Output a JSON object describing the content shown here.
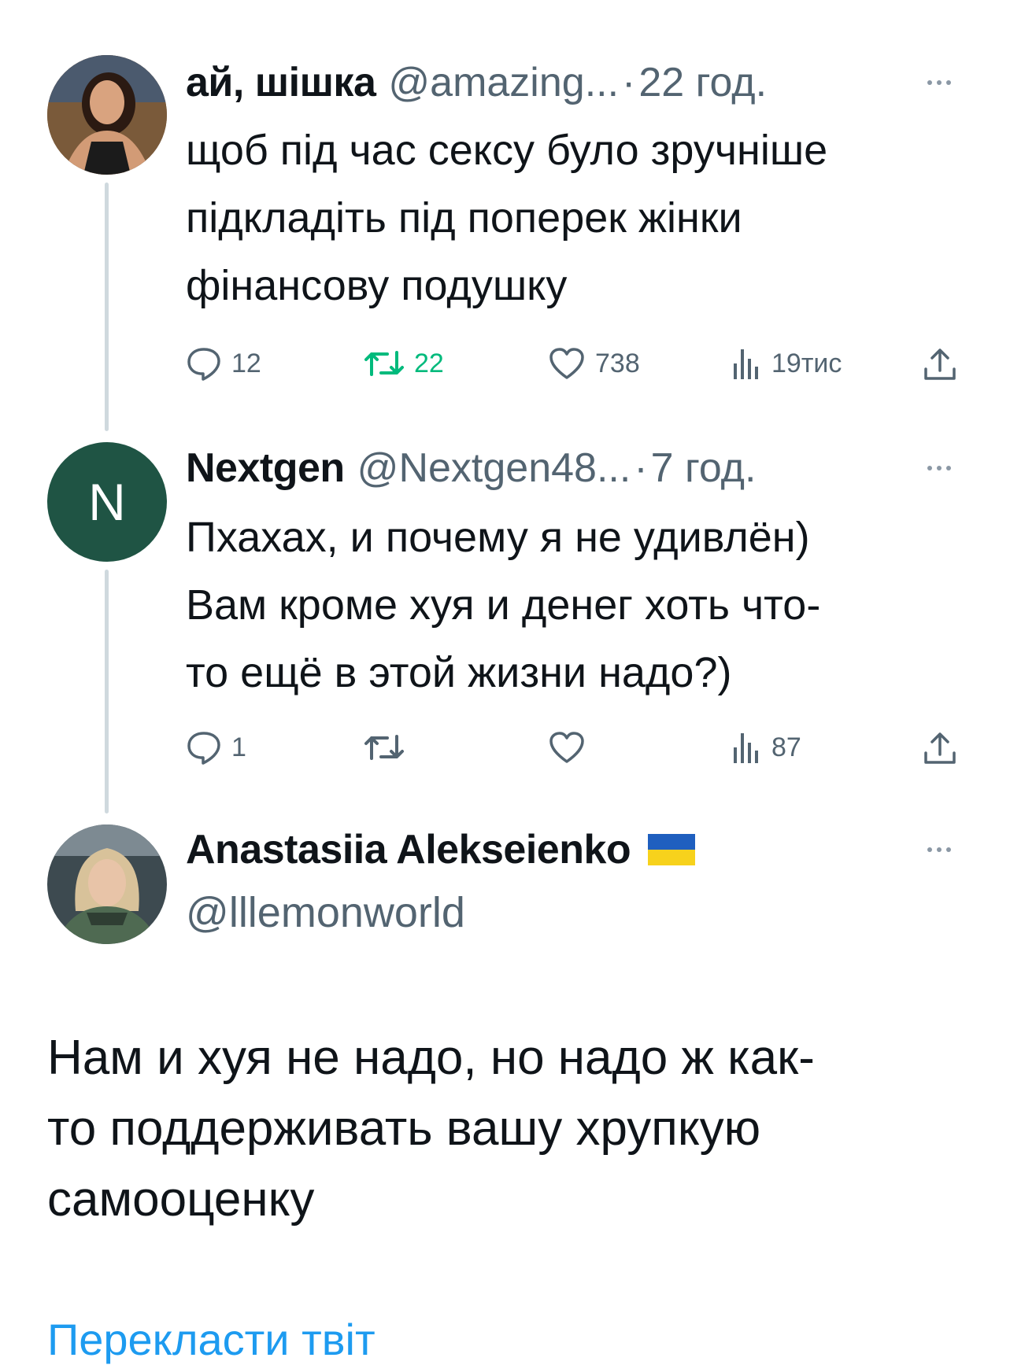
{
  "tweets": [
    {
      "name": "ай, шішка",
      "handle": "@amazing...",
      "dot": "·",
      "time": "22 год.",
      "text": "щоб під час сексу було зручніше\nпідкладіть під поперек жінки\nфінансову подушку",
      "replies": "12",
      "retweets": "22",
      "likes": "738",
      "views": "19тис"
    },
    {
      "name": "Nextgen",
      "handle": "@Nextgen48...",
      "dot": "·",
      "time": "7 год.",
      "avatar_letter": "N",
      "avatar_color": "#1f5444",
      "text": "Пхахах, и почему я не удивлён)\nВам кроме хуя и денег хоть что-\nто ещё в этой жизни надо?)",
      "replies": "1",
      "retweets": "",
      "likes": "",
      "views": "87"
    }
  ],
  "main_tweet": {
    "name": "Anastasiia Alekseienko",
    "flag_icon": "ukraine-flag",
    "handle": "@lllemonworld",
    "text": "Нам и хуя не надо, но надо ж как-\nто поддерживать вашу хрупкую\nсамооценку",
    "translate_label": "Перекласти твіт"
  },
  "colors": {
    "accent": "#1d9bf0",
    "muted": "#536471",
    "retweet_active": "#00ba7c",
    "thread_line": "#cfd9de"
  }
}
